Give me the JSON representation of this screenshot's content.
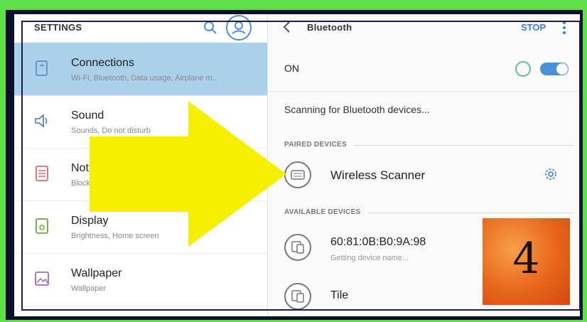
{
  "left_panel": {
    "title": "SETTINGS",
    "items": [
      {
        "title": "Connections",
        "subtitle": "Wi-Fi, Bluetooth, Data usage, Airplane m..."
      },
      {
        "title": "Sound",
        "subtitle": "Sounds, Do not disturb"
      },
      {
        "title": "Not",
        "subtitle": "Block"
      },
      {
        "title": "Display",
        "subtitle": "Brightness, Home screen"
      },
      {
        "title": "Wallpaper",
        "subtitle": "Wallpaper"
      }
    ]
  },
  "right_panel": {
    "title": "Bluetooth",
    "stop_label": "STOP",
    "on_label": "ON",
    "scanning_text": "Scanning for Bluetooth devices...",
    "paired_header": "PAIRED DEVICES",
    "available_header": "AVAILABLE DEVICES",
    "paired_devices": [
      {
        "name": "Wireless Scanner"
      }
    ],
    "available_devices": [
      {
        "name": "60:81:0B:B0:9A:98",
        "status": "Getting device name..."
      },
      {
        "name": "Tile"
      }
    ]
  },
  "overlay": {
    "badge_number": "4",
    "arrow_color": "#f7ef00",
    "frame_color": "#1a1d4f",
    "background_color": "#5fe04a"
  },
  "colors": {
    "accent": "#3c7fd6",
    "selected_row": "#aad0ea",
    "toggle_on": "#4a90d9"
  }
}
